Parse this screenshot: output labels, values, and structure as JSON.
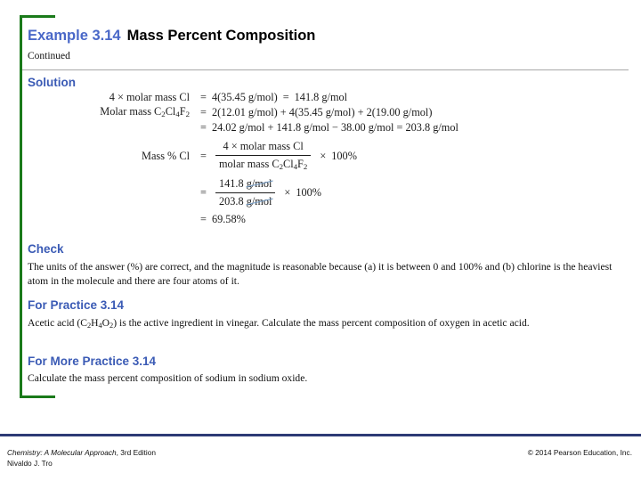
{
  "accent": {
    "green": "#1a7a1a",
    "heading_blue": "#3b5bb5",
    "title_blue": "#4a68c8",
    "footer_rule": "#2d3a75"
  },
  "header": {
    "example_label": "Example 3.14",
    "example_name": "Mass Percent Composition",
    "continued": "Continued"
  },
  "sections": {
    "solution_heading": "Solution",
    "check_heading": "Check",
    "check_text": "The units of the answer (%) are correct, and the magnitude is reasonable because (a) it is between 0 and 100% and (b) chlorine is the heaviest atom in the molecule and there are four atoms of it.",
    "practice_heading": "For Practice 3.14",
    "more_practice_heading": "For More Practice 3.14",
    "more_practice_text": "Calculate the mass percent composition of sodium in sodium oxide."
  },
  "practice_text": {
    "part1": "Acetic acid (C",
    "sub1": "2",
    "part2": "H",
    "sub2": "4",
    "part3": "O",
    "sub3": "2",
    "part4": ") is the active ingredient in vinegar. Calculate the mass percent composition of oxygen in acetic acid."
  },
  "math": {
    "row1": {
      "lhs_prefix": "4",
      "lhs_times": "×",
      "lhs_text": "molar mass Cl",
      "equals": "=",
      "rhs": "4(35.45 g/mol)",
      "equals2": "=",
      "result": "141.8 g/mol"
    },
    "row2": {
      "lhs_text": "Molar mass C",
      "lhs_sub1": "2",
      "lhs_mid1": "Cl",
      "lhs_sub2": "4",
      "lhs_mid2": "F",
      "lhs_sub3": "2",
      "equals": "=",
      "rhs": "2(12.01 g/mol) + 4(35.45 g/mol) + 2(19.00 g/mol)"
    },
    "row3": {
      "equals": "=",
      "rhs": "24.02 g/mol + 141.8 g/mol − 38.00 g/mol = 203.8 g/mol"
    },
    "row4": {
      "lhs": "Mass % Cl",
      "equals": "=",
      "num_prefix": "4",
      "num_times": "×",
      "num_text": "molar mass Cl",
      "den_text": "molar mass C",
      "den_sub1": "2",
      "den_mid1": "Cl",
      "den_sub2": "4",
      "den_mid2": "F",
      "den_sub3": "2",
      "times": "×",
      "tail": "100%"
    },
    "row5": {
      "equals": "=",
      "num_value": "141.8",
      "num_unit": "g/mol",
      "den_value": "203.8",
      "den_unit": "g/mol",
      "times": "×",
      "tail": "100%"
    },
    "row6": {
      "equals": "=",
      "result": "69.58%"
    }
  },
  "footer": {
    "book_title": "Chemistry: A Molecular Approach",
    "edition": ", 3rd Edition",
    "author": "Nivaldo J. Tro",
    "copyright": "© 2014 Pearson Education, Inc."
  }
}
